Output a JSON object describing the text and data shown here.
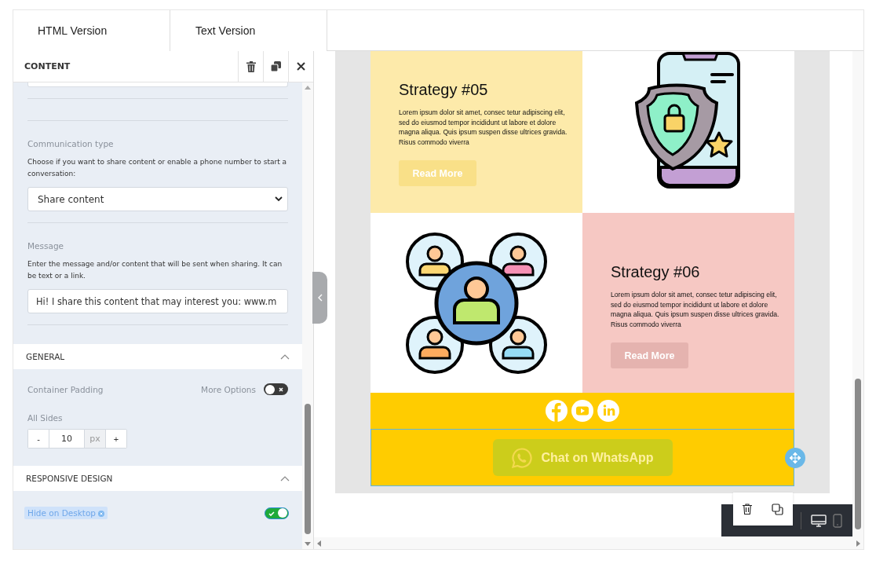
{
  "tabs": [
    {
      "label": "HTML Version"
    },
    {
      "label": "Text Version"
    }
  ],
  "panel": {
    "title": "CONTENT",
    "communication": {
      "label": "Communication type",
      "help": "Choose if you want to share content or enable a phone number to start a conversation:",
      "value": "Share content"
    },
    "message": {
      "label": "Message",
      "help": "Enter the message and/or content that will be sent when sharing. It can be text or a link.",
      "value": "Hi! I share this content that may interest you: www.m"
    },
    "general": {
      "title": "GENERAL",
      "expanded": true,
      "padding_label": "Container Padding",
      "more_options_label": "More Options",
      "more_options_on": false,
      "all_sides_label": "All Sides",
      "minus": "-",
      "value": "10",
      "unit": "px",
      "plus": "+"
    },
    "responsive": {
      "title": "RESPONSIVE DESIGN",
      "expanded": true,
      "tag": "Hide on Desktop",
      "on": true
    }
  },
  "email": {
    "rows": [
      {
        "title": "Strategy #05",
        "body": "Lorem ipsum dolor sit amet, consec tetur adipiscing elit, sed do eiusmod tempor incididunt ut labore et dolore magna aliqua. Quis ipsum suspen disse ultrices gravida. Risus commodo viverra",
        "button": "Read More",
        "color": "#fdeaaa",
        "kind": "phone"
      },
      {
        "title": "Strategy #06",
        "body": "Lorem ipsum dolor sit amet, consec tetur adipiscing elit, sed do eiusmod tempor incididunt ut labore et dolore magna aliqua. Quis ipsum suspen disse ultrices gravida. Risus commodo viverra",
        "button": "Read More",
        "color": "#f6c8c3",
        "kind": "people"
      }
    ],
    "whatsapp": "Chat on WhatsApp"
  },
  "views": [
    {
      "kind": "desktop",
      "selected": true
    },
    {
      "kind": "mobile",
      "selected": false
    }
  ]
}
